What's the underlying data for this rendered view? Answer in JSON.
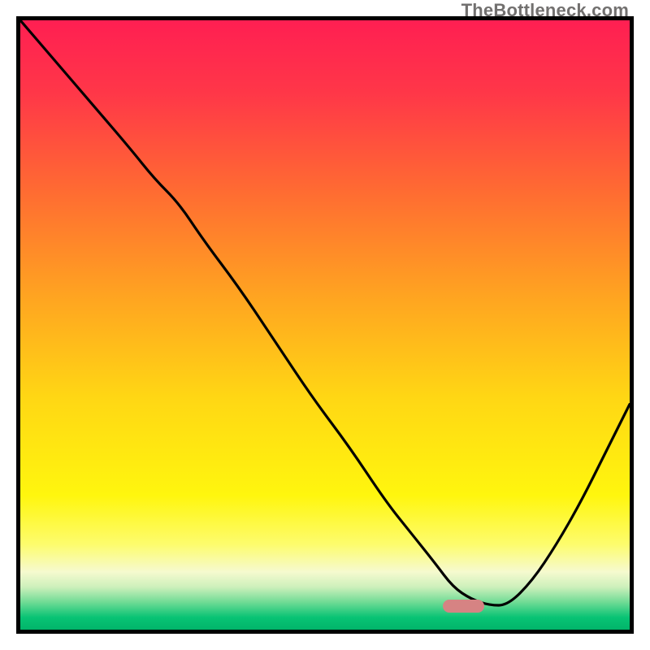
{
  "watermark": "TheBottleneck.com",
  "frame": {
    "border_color": "#000000",
    "border_width_px": 5
  },
  "gradient_stops": [
    {
      "offset": 0.0,
      "color": "#ff1f52"
    },
    {
      "offset": 0.12,
      "color": "#ff3748"
    },
    {
      "offset": 0.28,
      "color": "#ff6b32"
    },
    {
      "offset": 0.45,
      "color": "#ffa321"
    },
    {
      "offset": 0.62,
      "color": "#ffd714"
    },
    {
      "offset": 0.78,
      "color": "#fff60e"
    },
    {
      "offset": 0.86,
      "color": "#fdfc6d"
    },
    {
      "offset": 0.905,
      "color": "#f6facf"
    },
    {
      "offset": 0.93,
      "color": "#cdf0bb"
    },
    {
      "offset": 0.955,
      "color": "#6fdb95"
    },
    {
      "offset": 0.98,
      "color": "#08c374"
    },
    {
      "offset": 1.0,
      "color": "#02b56a"
    }
  ],
  "marker": {
    "x_frac": 0.727,
    "y_frac": 0.961,
    "w_frac": 0.068,
    "h_frac": 0.022,
    "color": "#d68383"
  },
  "chart_data": {
    "type": "line",
    "title": "",
    "xlabel": "",
    "ylabel": "",
    "xlim": [
      0,
      100
    ],
    "ylim": [
      0,
      100
    ],
    "y_axis_inverted": false,
    "grid": false,
    "note": "Axes are unlabeled; x and y are expressed as percentages of the plot area. y=0 is the bottom edge, y=100 is the top edge.",
    "series": [
      {
        "name": "curve",
        "color": "#000000",
        "x": [
          0,
          6,
          12,
          18,
          22,
          26,
          30,
          36,
          42,
          48,
          54,
          60,
          64,
          68,
          71,
          74,
          77,
          80,
          84,
          88,
          92,
          96,
          100
        ],
        "y": [
          100,
          93,
          86,
          79,
          74,
          70,
          64,
          56,
          47,
          38,
          30,
          21,
          16,
          11,
          7,
          5,
          4,
          4,
          8,
          14,
          21,
          29,
          37
        ]
      }
    ],
    "background": {
      "type": "vertical_gradient",
      "description": "Background shades from red at top through orange/yellow to green at bottom, indicating a 'lower is better / bottleneck' heat scale."
    },
    "highlight_region": {
      "description": "Rounded marker indicating minimum / optimal point of the curve",
      "x_range_pct": [
        72.7,
        79.5
      ],
      "y_center_pct": 3.9,
      "color": "#d68383"
    }
  }
}
